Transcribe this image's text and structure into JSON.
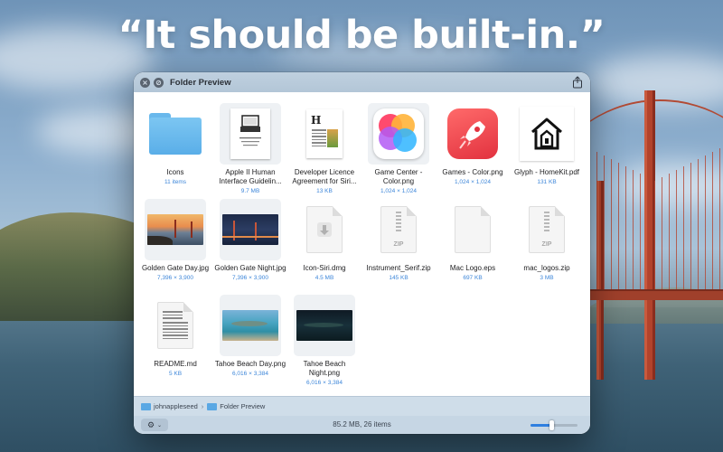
{
  "headline": "“It should be built-in.”",
  "window": {
    "title": "Folder Preview",
    "titlebar_buttons": [
      "close-icon",
      "minimize-icon"
    ],
    "share_icon": "share-icon"
  },
  "items": [
    {
      "name": "Icons",
      "meta": "11 items",
      "kind": "folder"
    },
    {
      "name": "Apple II Human Interface Guidelin...",
      "meta": "9.7 MB",
      "kind": "document"
    },
    {
      "name": "Developer Licence Agreement for Siri...",
      "meta": "13 KB",
      "kind": "document"
    },
    {
      "name": "Game Center - Color.png",
      "meta": "1,024 × 1,024",
      "kind": "app-icon"
    },
    {
      "name": "Games - Color.png",
      "meta": "1,024 × 1,024",
      "kind": "app-icon"
    },
    {
      "name": "Glyph - HomeKit.pdf",
      "meta": "131 KB",
      "kind": "pdf"
    },
    {
      "name": "Golden Gate Day.jpg",
      "meta": "7,396 × 3,900",
      "kind": "photo"
    },
    {
      "name": "Golden Gate Night.jpg",
      "meta": "7,396 × 3,900",
      "kind": "photo"
    },
    {
      "name": "Icon-Siri.dmg",
      "meta": "4.5 MB",
      "kind": "disk-image"
    },
    {
      "name": "Instrument_Serif.zip",
      "meta": "145 KB",
      "kind": "zip"
    },
    {
      "name": "Mac Logo.eps",
      "meta": "697 KB",
      "kind": "file"
    },
    {
      "name": "mac_logos.zip",
      "meta": "3 MB",
      "kind": "zip"
    },
    {
      "name": "README.md",
      "meta": "5 KB",
      "kind": "text"
    },
    {
      "name": "Tahoe Beach Day.png",
      "meta": "6,016 × 3,384",
      "kind": "photo"
    },
    {
      "name": "Tahoe Beach Night.png",
      "meta": "6,016 × 3,384",
      "kind": "photo"
    }
  ],
  "icon_labels": {
    "zip": "ZIP"
  },
  "pathbar": {
    "user": "johnappleseed",
    "folder": "Folder Preview"
  },
  "statusbar": {
    "summary": "85.2 MB, 26 items",
    "zoom_level": 0.45
  },
  "colors": {
    "accent": "#3d86d9",
    "folder": "#5aaee8",
    "window_chrome": "#c6d6e4"
  }
}
